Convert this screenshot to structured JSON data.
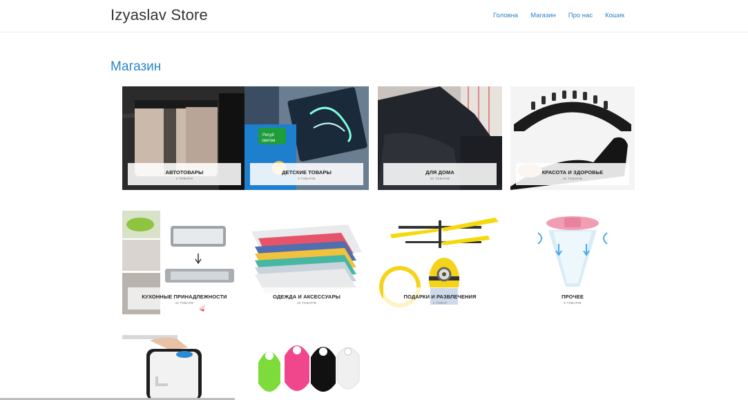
{
  "header": {
    "brand": "Izyaslav Store",
    "nav": [
      "Головна",
      "Магазин",
      "Про нас",
      "Кошик"
    ]
  },
  "page": {
    "title": "Магазин"
  },
  "categories": [
    {
      "title": "АВТОТОВАРЫ",
      "count": "2 ТОВАРИ"
    },
    {
      "title": "ДЕТСКИЕ ТОВАРЫ",
      "count": "9 ТОВАРІВ"
    },
    {
      "title": "ДЛЯ ДОМА",
      "count": "30 ТОВАРІВ"
    },
    {
      "title": "КРАСОТА И ЗДОРОВЬЕ",
      "count": "46 ТОВАРІВ"
    },
    {
      "title": "КУХОННЫЕ ПРИНАДЛЕЖНОСТИ",
      "count": "43 ТОВАРИ"
    },
    {
      "title": "ОДЕЖДА И АКСЕССУАРЫ",
      "count": "19 ТОВАРІВ"
    },
    {
      "title": "ПОДАРКИ И РАЗВЛЕЧЕНИЯ",
      "count": "1 ТОВАР"
    },
    {
      "title": "ПРОЧЕЕ",
      "count": "9 ТОВАРІВ"
    }
  ],
  "image_alts": {
    "car_organizer": "car-seat-organizer",
    "kids_drawing": "kids-light-drawing-board",
    "sofa_cover": "sofa-cover",
    "back_stretcher": "back-stretcher",
    "dish_rack": "collapsible-dish-rack",
    "clothes_organizer": "clothes-folding-organizer",
    "minion_heli": "minion-flying-toy",
    "lint_filter": "washing-machine-filter",
    "water_pump": "water-dispenser-pump",
    "key_finder": "bluetooth-key-finder"
  }
}
